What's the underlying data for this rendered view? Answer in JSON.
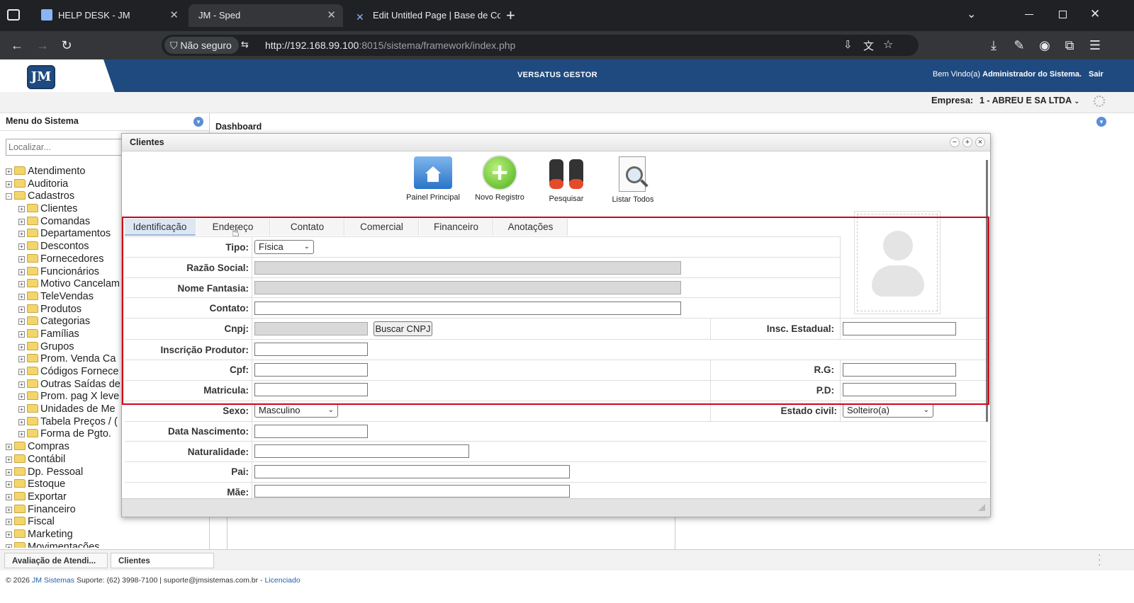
{
  "browser": {
    "tabs": [
      {
        "label": "HELP DESK - JM"
      },
      {
        "label": "JM - Sped"
      },
      {
        "label": "Edit Untitled Page | Base de Co"
      }
    ],
    "security_label": "Não seguro",
    "url_host": "http://192.168.99.100",
    "url_path": ":8015/sistema/framework/index.php"
  },
  "header": {
    "logo_text": "JM",
    "title": "VERSATUS GESTOR",
    "welcome_prefix": "Bem Vindo(a)",
    "welcome_user": "Administrador do Sistema.",
    "logout": "Sair",
    "company_label": "Empresa:",
    "company_value": "1 - ABREU E SA LTDA"
  },
  "sidebar": {
    "title": "Menu do Sistema",
    "search_placeholder": "Localizar...",
    "tree": [
      {
        "label": "Atendimento",
        "level": 0,
        "sign": "+"
      },
      {
        "label": "Auditoria",
        "level": 0,
        "sign": "+"
      },
      {
        "label": "Cadastros",
        "level": 0,
        "sign": "-"
      },
      {
        "label": "Clientes",
        "level": 1,
        "sign": "+"
      },
      {
        "label": "Comandas",
        "level": 1,
        "sign": "+"
      },
      {
        "label": "Departamentos",
        "level": 1,
        "sign": "+"
      },
      {
        "label": "Descontos",
        "level": 1,
        "sign": "+"
      },
      {
        "label": "Fornecedores",
        "level": 1,
        "sign": "+"
      },
      {
        "label": "Funcionários",
        "level": 1,
        "sign": "+"
      },
      {
        "label": "Motivo Cancelam",
        "level": 1,
        "sign": "+"
      },
      {
        "label": "TeleVendas",
        "level": 1,
        "sign": "+"
      },
      {
        "label": "Produtos",
        "level": 1,
        "sign": "+"
      },
      {
        "label": "Categorias",
        "level": 1,
        "sign": "+"
      },
      {
        "label": "Famílias",
        "level": 1,
        "sign": "+"
      },
      {
        "label": "Grupos",
        "level": 1,
        "sign": "+"
      },
      {
        "label": "Prom. Venda Ca",
        "level": 1,
        "sign": "+"
      },
      {
        "label": "Códigos Fornece",
        "level": 1,
        "sign": "+"
      },
      {
        "label": "Outras Saídas de",
        "level": 1,
        "sign": "+"
      },
      {
        "label": "Prom. pag X leve",
        "level": 1,
        "sign": "+"
      },
      {
        "label": "Unidades de Me",
        "level": 1,
        "sign": "+"
      },
      {
        "label": "Tabela Preços / (",
        "level": 1,
        "sign": "+"
      },
      {
        "label": "Forma de Pgto.",
        "level": 1,
        "sign": "+"
      },
      {
        "label": "Compras",
        "level": 0,
        "sign": "+"
      },
      {
        "label": "Contábil",
        "level": 0,
        "sign": "+"
      },
      {
        "label": "Dp. Pessoal",
        "level": 0,
        "sign": "+"
      },
      {
        "label": "Estoque",
        "level": 0,
        "sign": "+"
      },
      {
        "label": "Exportar",
        "level": 0,
        "sign": "+"
      },
      {
        "label": "Financeiro",
        "level": 0,
        "sign": "+"
      },
      {
        "label": "Fiscal",
        "level": 0,
        "sign": "+"
      },
      {
        "label": "Marketing",
        "level": 0,
        "sign": "+"
      },
      {
        "label": "Movimentações",
        "level": 0,
        "sign": "+"
      }
    ]
  },
  "dashboard": {
    "title": "Dashboard"
  },
  "window": {
    "title": "Clientes",
    "toolbar": {
      "home": "Painel Principal",
      "new": "Novo Registro",
      "search": "Pesquisar",
      "list": "Listar Todos"
    },
    "tabs": [
      "Identificação",
      "Endereço",
      "Contato",
      "Comercial",
      "Financeiro",
      "Anotações"
    ],
    "form": {
      "tipo_label": "Tipo:",
      "tipo_value": "Física",
      "razao_label": "Razão Social:",
      "fantasia_label": "Nome Fantasia:",
      "contato_label": "Contato:",
      "cnpj_label": "Cnpj:",
      "buscar_cnpj": "Buscar CNPJ",
      "insc_estadual_label": "Insc. Estadual:",
      "insc_produtor_label": "Inscrição Produtor:",
      "cpf_label": "Cpf:",
      "rg_label": "R.G:",
      "matricula_label": "Matricula:",
      "pd_label": "P.D:",
      "sexo_label": "Sexo:",
      "sexo_value": "Masculino",
      "estado_civil_label": "Estado civil:",
      "estado_civil_value": "Solteiro(a)",
      "nascimento_label": "Data Nascimento:",
      "naturalidade_label": "Naturalidade:",
      "pai_label": "Pai:",
      "mae_label": "Mãe:"
    }
  },
  "footer": {
    "tabs": [
      "Avaliação de Atendi...",
      "Clientes"
    ],
    "copyright_prefix": "© 2026",
    "company_link": "JM Sistemas",
    "support": "Suporte: (62) 3998-7100 | suporte@jmsistemas.com.br -",
    "license_link": "Licenciado"
  },
  "colors": {
    "header_blue": "#1f4a80",
    "highlight_red": "#d0021b"
  }
}
